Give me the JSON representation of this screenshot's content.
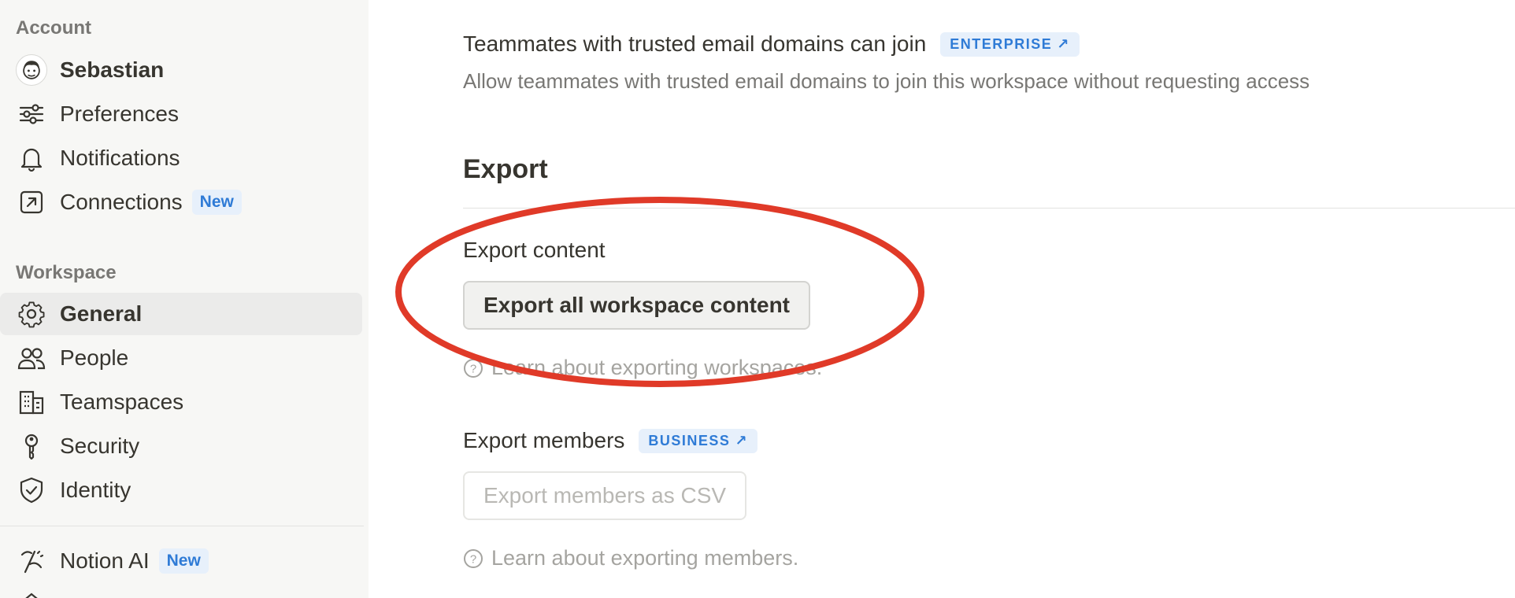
{
  "sidebar": {
    "account_label": "Account",
    "workspace_label": "Workspace",
    "account_items": [
      {
        "label": "Sebastian",
        "icon": "avatar"
      },
      {
        "label": "Preferences",
        "icon": "sliders-icon"
      },
      {
        "label": "Notifications",
        "icon": "bell-icon"
      },
      {
        "label": "Connections",
        "icon": "external-link-icon",
        "badge": "New"
      }
    ],
    "workspace_items": [
      {
        "label": "General",
        "icon": "gear-icon",
        "active": true
      },
      {
        "label": "People",
        "icon": "people-icon"
      },
      {
        "label": "Teamspaces",
        "icon": "building-icon"
      },
      {
        "label": "Security",
        "icon": "key-icon"
      },
      {
        "label": "Identity",
        "icon": "shield-check-icon"
      }
    ],
    "extra_items": [
      {
        "label": "Notion AI",
        "icon": "notion-ai-icon",
        "badge": "New"
      }
    ]
  },
  "main": {
    "trusted_domains": {
      "title": "Teammates with trusted email domains can join",
      "badge": "ENTERPRISE",
      "description": "Allow teammates with trusted email domains to join this workspace without requesting access"
    },
    "export_heading": "Export",
    "export_content": {
      "title": "Export content",
      "button": "Export all workspace content",
      "help": "Learn about exporting workspaces."
    },
    "export_members": {
      "title": "Export members",
      "badge": "BUSINESS",
      "button": "Export members as CSV",
      "help": "Learn about exporting members."
    }
  },
  "colors": {
    "sidebar_bg": "#f7f7f5",
    "badge_blue": "#2f7bd6",
    "annotation_red": "#e03a28"
  }
}
